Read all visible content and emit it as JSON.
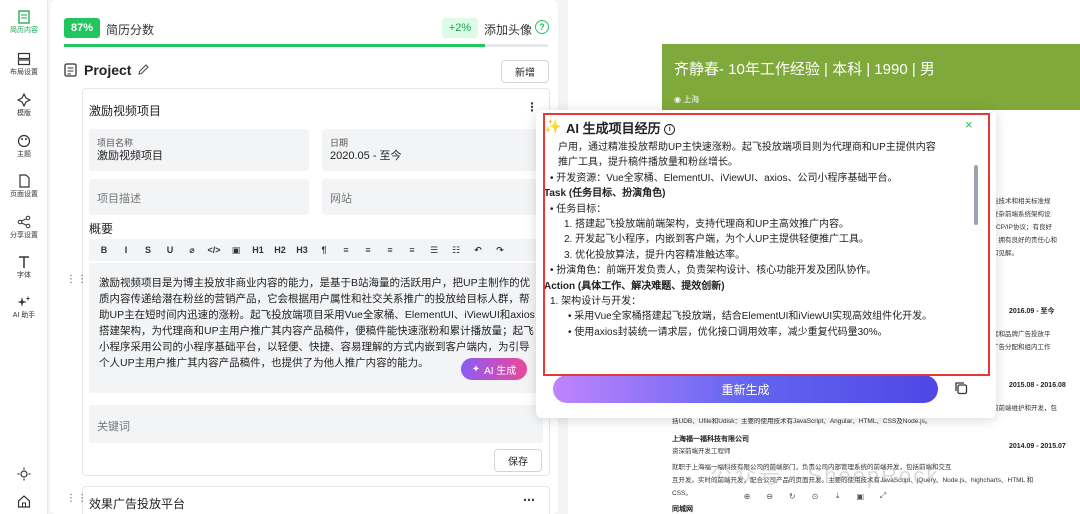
{
  "nav": [
    {
      "label": "简历内容",
      "icon": "document-icon"
    },
    {
      "label": "布局设置",
      "icon": "layout-icon"
    },
    {
      "label": "模版",
      "icon": "template-icon"
    },
    {
      "label": "主题",
      "icon": "palette-icon"
    },
    {
      "label": "页面设置",
      "icon": "page-icon"
    },
    {
      "label": "分享设置",
      "icon": "share-icon"
    },
    {
      "label": "字体",
      "icon": "font-icon"
    },
    {
      "label": "AI 助手",
      "icon": "sparkle-icon"
    }
  ],
  "nav_bottom": [
    "sun-icon",
    "home-icon"
  ],
  "score": {
    "percent": "87%",
    "label": "简历分数",
    "progress": 0.87,
    "tip": "+2%",
    "tip_label": "添加头像",
    "help": "?"
  },
  "section": {
    "title": "Project",
    "add_label": "新增"
  },
  "project": {
    "title": "激励视频项目",
    "name_label": "项目名称",
    "name_value": "激励视频项目",
    "date_label": "日期",
    "date_value": "2020.05 - 至今",
    "desc_placeholder": "项目描述",
    "website_placeholder": "网站",
    "summary_label": "概要",
    "toolbar": [
      "B",
      "I",
      "S",
      "U",
      "⌀",
      "</>",
      "▣",
      "H1",
      "H2",
      "H3",
      "¶",
      "≡",
      "≡",
      "≡",
      "≡",
      "☰",
      "☷",
      "↶",
      "↷"
    ],
    "description": "激励视频项目是为博主投放非商业内容的能力，是基于B站海量的活跃用户，把UP主制作的优质内容传递给潜在粉丝的营销产品，它会根据用户属性和社交关系推广的投放给目标人群，帮助UP主在短时间内迅速的涨粉。起飞投放端项目采用Vue全家桶、ElementUI、iViewUI和axios搭建架构，为代理商和UP主用户推广其内容产品稿件，便稿件能快速涨粉和累计播放量；起飞小程序采用公司的小程序基础平台，以轻便、快捷、容易理解的方式内嵌到客户端内，为引导个人UP主用户推广其内容产品稿件，也提供了为他人推广内容的能力。",
    "ai_label": "AI 生成",
    "keywords_placeholder": "关键词",
    "save_label": "保存"
  },
  "project2": {
    "title": "效果广告投放平台"
  },
  "preview": {
    "header": "齐静春- 10年工作经验 | 本科 | 1990 | 男",
    "location": "上海",
    "right_lines": [
      "能技术和相关标准规",
      "复杂前端系统架构设",
      "TCP/IP协议；有良好",
      "，拥有良好的责任心和",
      "和见解。"
    ],
    "date1": "2016.09 - 至今",
    "right_lines2": [
      "案和品牌广告投放平",
      "广告分配和组内工作"
    ],
    "date2": "2015.08 - 2016.08",
    "line_a": "的前端维护和开发，包",
    "line_b": "括UDB、Ufile和Udisk：主要的使用技术有JavaScript、Angular、HTML、CSS及Node.js。",
    "company": "上海福一福科技有限公司",
    "date3": "2014.09 - 2015.07",
    "role": "资深前端开发工程师",
    "body": [
      "就职于上海福一福科技有限公司的前端部门，负责公司内部管理系统的前端开发，包括前端和交互",
      "互开发。实时的前端开发，配合公司产品的页面开发。主要的使用技术有JavaScript、jQuery、Node.js、highcharts、HTML 和",
      "CSS。"
    ],
    "last": "同城网",
    "watermark": "公众号 · SheepRock"
  },
  "bottom_tools": [
    "⊕",
    "⊖",
    "↻",
    "⊙",
    "⤓",
    "▣",
    "⤢"
  ],
  "modal": {
    "title": "AI 生成项目经历",
    "info": "i",
    "close": "×",
    "lines": [
      {
        "t": "户用，通过精准投放帮助UP主快速涨粉。起飞投放端项目则为代理商和UP主提供内容",
        "x": 14,
        "h": false
      },
      {
        "t": "推广工具，提升稿件播放量和粉丝增长。",
        "x": 14,
        "h": false
      },
      {
        "t": "•  开发资源：Vue全家桶、ElementUI、iViewUI、axios、公司小程序基础平台。",
        "x": 6,
        "h": false,
        "bold": "开发资源"
      },
      {
        "t": "Task (任务目标、扮演角色)",
        "x": 0,
        "h": true
      },
      {
        "t": "•  任务目标：",
        "x": 6,
        "h": false
      },
      {
        "t": "1. 搭建起飞投放端前端架构，支持代理商和UP主高效推广内容。",
        "x": 20,
        "h": false
      },
      {
        "t": "2. 开发起飞小程序，内嵌到客户端，为个人UP主提供轻便推广工具。",
        "x": 20,
        "h": false
      },
      {
        "t": "3. 优化投放算法，提升内容精准触达率。",
        "x": 20,
        "h": false
      },
      {
        "t": "•  扮演角色：前端开发负责人，负责架构设计、核心功能开发及团队协作。",
        "x": 6,
        "h": false
      },
      {
        "t": "Action (具体工作、解决难题、提效创新)",
        "x": 0,
        "h": true
      },
      {
        "t": "1. 架构设计与开发：",
        "x": 6,
        "h": false
      },
      {
        "t": "•  采用Vue全家桶搭建起飞投放端，结合ElementUI和iViewUI实现高效组件化开发。",
        "x": 24,
        "h": false
      },
      {
        "t": "•  使用axios封装统一请求层，优化接口调用效率，减少重复代码量30%。",
        "x": 24,
        "h": false
      }
    ],
    "regen_label": "重新生成"
  }
}
